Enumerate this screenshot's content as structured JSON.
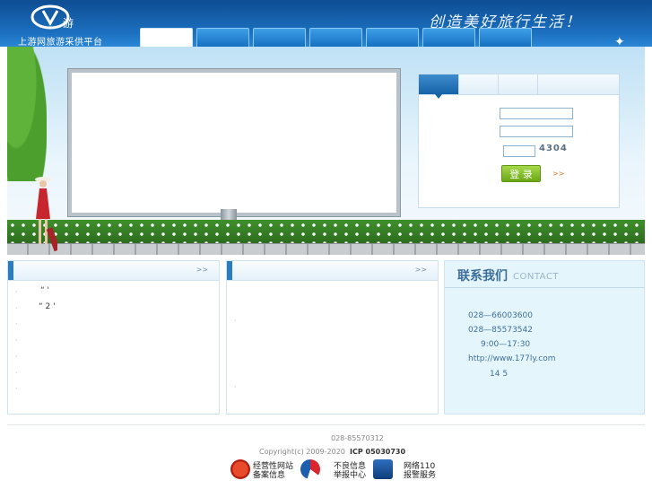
{
  "header": {
    "logo_text": "上游网旅游采供平台",
    "slogan": "创造美好旅行生活！",
    "nav_tabs": [
      "",
      "",
      "",
      "",
      "",
      "",
      ""
    ]
  },
  "login": {
    "tabs": [
      "",
      "",
      "",
      ""
    ],
    "username_value": "",
    "password_value": "",
    "captcha_value": "",
    "captcha_image_text": "4304",
    "submit_label": "登 录",
    "more_link": ">>"
  },
  "panel_left": {
    "more_link": ">>",
    "items": [
      "“ '",
      "“  2 '",
      "",
      "",
      "",
      "",
      ""
    ]
  },
  "panel_middle": {
    "more_link": ">>"
  },
  "contact": {
    "title": "联系我们",
    "subtitle": "CONTACT",
    "lines": [
      "028—66003600",
      "028—85573542",
      "9:00—17:30",
      "http://www.177ly.com",
      "14   5"
    ]
  },
  "footer": {
    "phone": "028-85570312",
    "copyright": "Copyright(c) 2009-2020",
    "icp": "ICP 05030730",
    "badges": [
      {
        "line1": "经营性网站",
        "line2": "备案信息"
      },
      {
        "line1": "不良信息",
        "line2": "举报中心"
      },
      {
        "line1": "网络110",
        "line2": "报警服务"
      }
    ]
  },
  "colors": {
    "header_blue": "#1c6fbf",
    "accent_green": "#6ba616",
    "contact_bg": "#e4f5fc"
  }
}
